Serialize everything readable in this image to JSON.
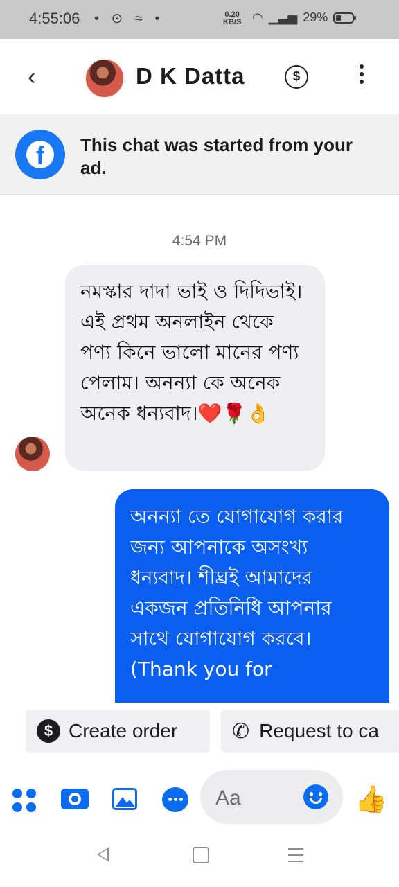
{
  "status_bar": {
    "time": "4:55:06",
    "icons_left": "• ⊙ ≈ •",
    "speed_value": "0.20",
    "speed_unit": "KB/S",
    "battery": "29%",
    "battery_level": 0.29
  },
  "header": {
    "back_glyph": "‹",
    "contact_name": "D K Datta",
    "dollar_glyph": "$"
  },
  "banner": {
    "text": "This chat was started from your ad."
  },
  "chat": {
    "timestamp": "4:54 PM",
    "incoming": {
      "text": "নমস্কার দাদা ভাই ও দিদিভাই। এই প্রথম অনলাইন থেকে পণ্য কিনে ভালো মানের পণ্য পেলাম। অনন্যা কে অনেক অনেক ধন্যবাদ।❤️🌹👌"
    },
    "outgoing": {
      "text": "অনন্যা তে যোগাযোগ করার জন্য আপনাকে অসংখ্য ধন্যবাদ। শীঘ্রই আমাদের একজন প্রতিনিধি আপনার সাথে যোগাযোগ করবে। (Thank you for"
    }
  },
  "quick_actions": {
    "create_order": "Create order",
    "create_order_icon": "$",
    "request_call": "Request to ca",
    "request_call_icon": "✆"
  },
  "composer": {
    "placeholder": "Aa",
    "like_glyph": "👍"
  },
  "colors": {
    "accent": "#0a5ff0",
    "incoming_bubble": "#efeff1",
    "facebook_blue": "#1877f2"
  }
}
